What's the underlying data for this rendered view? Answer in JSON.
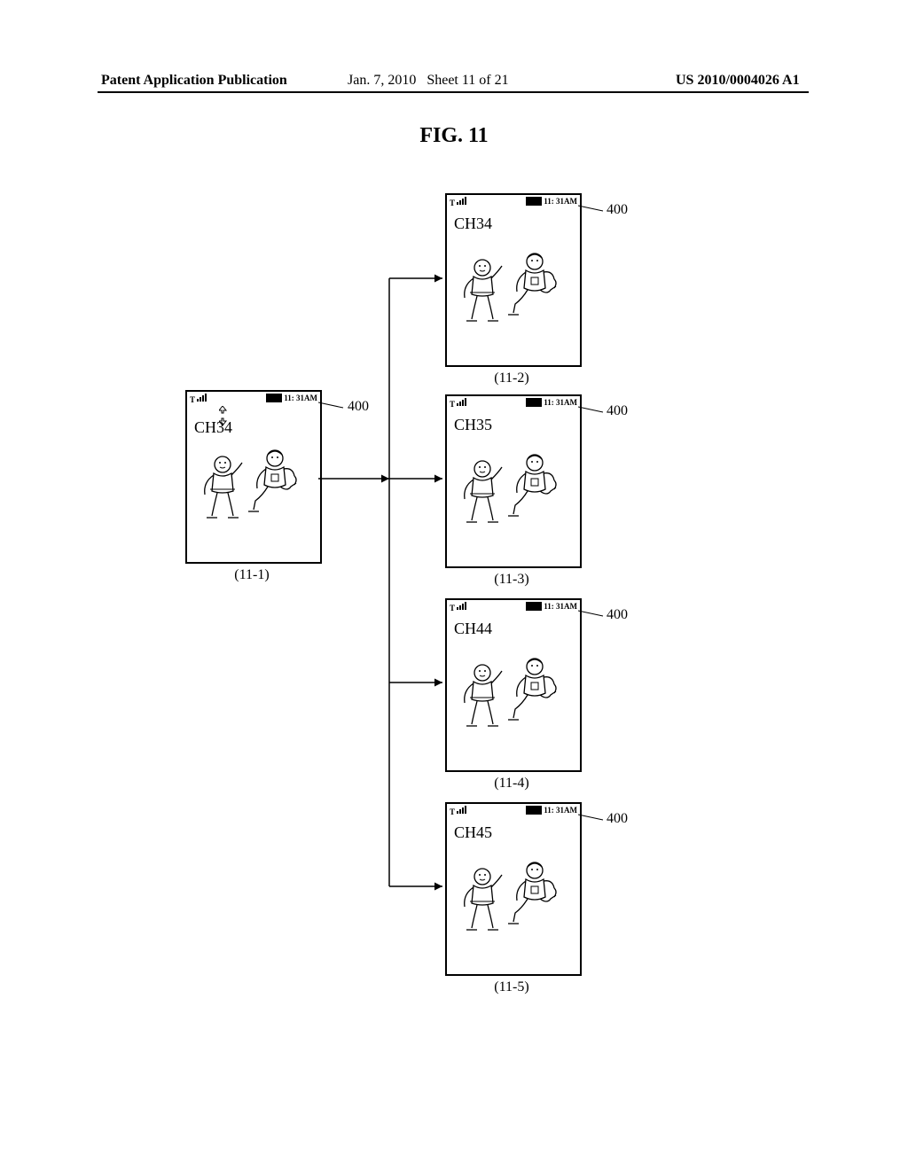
{
  "header": {
    "left": "Patent Application Publication",
    "date": "Jan. 7, 2010",
    "sheet": "Sheet 11 of 21",
    "pubno": "US 2010/0004026 A1"
  },
  "figure_title": "FIG. 11",
  "status_time": "11: 31AM",
  "signal_label": "T",
  "phones": {
    "p1": {
      "channel": "CH34",
      "caption": "(11-1)",
      "lead": "400"
    },
    "p2": {
      "channel": "CH34",
      "caption": "(11-2)",
      "lead": "400"
    },
    "p3": {
      "channel": "CH35",
      "caption": "(11-3)",
      "lead": "400"
    },
    "p4": {
      "channel": "CH44",
      "caption": "(11-4)",
      "lead": "400"
    },
    "p5": {
      "channel": "CH45",
      "caption": "(11-5)",
      "lead": "400"
    }
  },
  "chart_data": {
    "type": "table",
    "description": "Flow diagram: one source phone screen (11-1) branches to four result phone screens (11-2..11-5). All screens share status bar T signal, battery, 11:31AM. Channel labels differ.",
    "nodes": [
      {
        "id": "11-1",
        "channel": "CH34",
        "ref": "400"
      },
      {
        "id": "11-2",
        "channel": "CH34",
        "ref": "400"
      },
      {
        "id": "11-3",
        "channel": "CH35",
        "ref": "400"
      },
      {
        "id": "11-4",
        "channel": "CH44",
        "ref": "400"
      },
      {
        "id": "11-5",
        "channel": "CH45",
        "ref": "400"
      }
    ],
    "edges": [
      {
        "from": "11-1",
        "to": "11-2"
      },
      {
        "from": "11-1",
        "to": "11-3"
      },
      {
        "from": "11-1",
        "to": "11-4"
      },
      {
        "from": "11-1",
        "to": "11-5"
      }
    ]
  }
}
